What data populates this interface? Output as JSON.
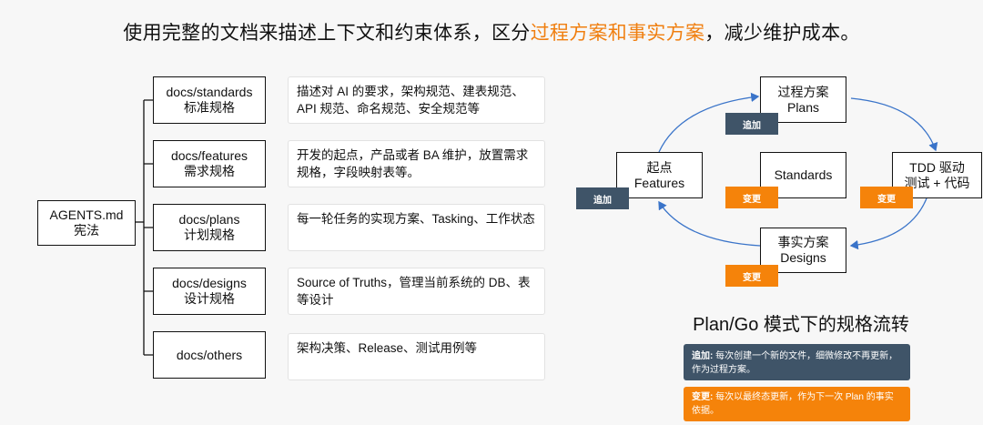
{
  "header": {
    "prefix": "使用完整的文档来描述上下文和约束体系，区分",
    "highlight": "过程方案和事实方案",
    "suffix": "，减少维护成本。"
  },
  "root": {
    "title": "AGENTS.md",
    "subtitle": "宪法"
  },
  "docs": [
    {
      "path": "docs/standards",
      "label": "标准规格",
      "desc": "描述对 AI 的要求，架构规范、建表规范、API 规范、命名规范、安全规范等"
    },
    {
      "path": "docs/features",
      "label": "需求规格",
      "desc": "开发的起点，产品或者 BA 维护，放置需求规格，字段映射表等。"
    },
    {
      "path": "docs/plans",
      "label": "计划规格",
      "desc": "每一轮任务的实现方案、Tasking、工作状态"
    },
    {
      "path": "docs/designs",
      "label": "设计规格",
      "desc": "Source of Truths，管理当前系统的 DB、表等设计"
    },
    {
      "path": "docs/others",
      "label": "",
      "desc": "架构决策、Release、测试用例等"
    }
  ],
  "cycle": {
    "plans": {
      "line1": "过程方案",
      "line2": "Plans"
    },
    "tdd": {
      "line1": "TDD 驱动",
      "line2": "测试 + 代码"
    },
    "designs": {
      "line1": "事实方案",
      "line2": "Designs"
    },
    "features": {
      "line1": "起点",
      "line2": "Features"
    },
    "standards": {
      "line1": "Standards"
    },
    "tag_add": "追加",
    "tag_change": "变更"
  },
  "flow_title": "Plan/Go 模式下的规格流转",
  "legend": {
    "add_key": "追加:",
    "add_text": " 每次创建一个新的文件，细微修改不再更新，作为过程方案。",
    "change_key": "变更:",
    "change_text": " 每次以最终态更新，作为下一次 Plan 的事实依据。"
  },
  "colors": {
    "accent": "#f07f10",
    "add_tag": "#3f5468",
    "change_tag": "#f5830a"
  }
}
